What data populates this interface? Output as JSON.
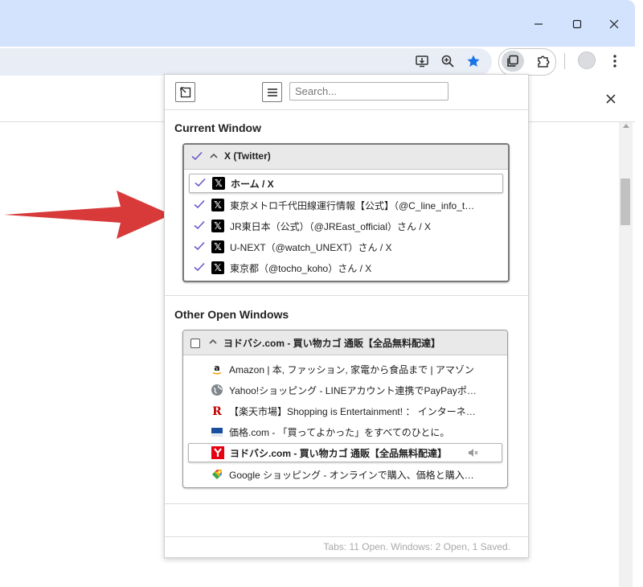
{
  "colors": {
    "accent": "#6a5acd",
    "title_bar": "#d3e3fd",
    "star": "#1a73e8",
    "arrow": "#d83a3a"
  },
  "browser": {
    "window_controls": [
      "minimize-icon",
      "maximize-icon",
      "close-icon"
    ],
    "toolbar_icons": [
      "install-icon",
      "zoom-icon",
      "star-icon",
      "tab-manager-icon",
      "extensions-icon",
      "profile-icon",
      "menu-icon"
    ]
  },
  "popup": {
    "search_placeholder": "Search...",
    "current_window": {
      "section_title": "Current Window",
      "window_title": "X (Twitter)",
      "tabs": [
        {
          "title": "ホーム / X",
          "favicon": "x-icon",
          "checked": true,
          "active": true
        },
        {
          "title": "東京メトロ千代田線運行情報【公式】（@C_line_info_tokyometro）さん / X",
          "favicon": "x-icon",
          "checked": true,
          "active": false
        },
        {
          "title": "JR東日本（公式）（@JREast_official）さん / X",
          "favicon": "x-icon",
          "checked": true,
          "active": false
        },
        {
          "title": "U-NEXT（@watch_UNEXT）さん / X",
          "favicon": "x-icon",
          "checked": true,
          "active": false
        },
        {
          "title": "東京都（@tocho_koho）さん / X",
          "favicon": "x-icon",
          "checked": true,
          "active": false
        }
      ]
    },
    "other_windows": {
      "section_title": "Other Open Windows",
      "window_title": "ヨドバシ.com - 買い物カゴ 通販【全品無料配達】",
      "tabs": [
        {
          "title": "Amazon | 本, ファッション, 家電から食品まで | アマゾン",
          "favicon": "amazon-icon",
          "active": false
        },
        {
          "title": "Yahoo!ショッピング - LINEアカウント連携でPayPayポイント",
          "favicon": "globe-icon",
          "active": false
        },
        {
          "title": "【楽天市場】Shopping is Entertainment! ： インターネット",
          "favicon": "rakuten-icon",
          "active": false
        },
        {
          "title": "価格.com - 「買ってよかった」をすべてのひとに。",
          "favicon": "kakaku-icon",
          "active": false
        },
        {
          "title": "ヨドバシ.com - 買い物カゴ 通販【全品無料配達】",
          "favicon": "yodobashi-icon",
          "active": true,
          "muted": true
        },
        {
          "title": "Google ショッピング - オンラインで購入、価格と購入先を比較",
          "favicon": "google-shopping-icon",
          "active": false
        }
      ]
    },
    "footer": "Tabs: 11 Open. Windows: 2 Open, 1 Saved."
  }
}
